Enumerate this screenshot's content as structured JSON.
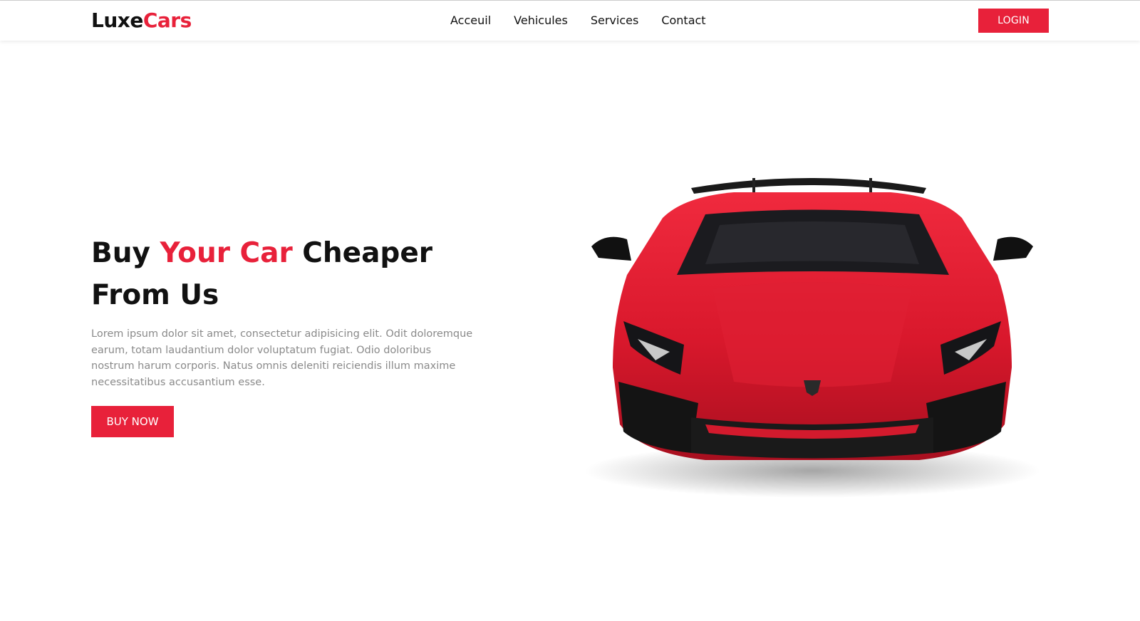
{
  "header": {
    "logo_part1": "Luxe",
    "logo_part2": "Cars",
    "nav": [
      {
        "label": "Acceuil"
      },
      {
        "label": "Vehicules"
      },
      {
        "label": "Services"
      },
      {
        "label": "Contact"
      }
    ],
    "login_label": "LOGIN"
  },
  "hero": {
    "title_part1": "Buy ",
    "title_highlight": "Your Car",
    "title_part2": " Cheaper",
    "title_line2": "From Us",
    "description": "Lorem ipsum dolor sit amet, consectetur adipisicing elit. Odit doloremque earum, totam laudantium dolor voluptatum fugiat. Odio doloribus nostrum harum corporis. Natus omnis deleniti reiciendis illum maxime necessitatibus accusantium esse.",
    "button_label": "BUY NOW",
    "image": "red-sports-car"
  },
  "colors": {
    "accent": "#e8213a",
    "text": "#111111",
    "muted": "#8a8a8a"
  }
}
